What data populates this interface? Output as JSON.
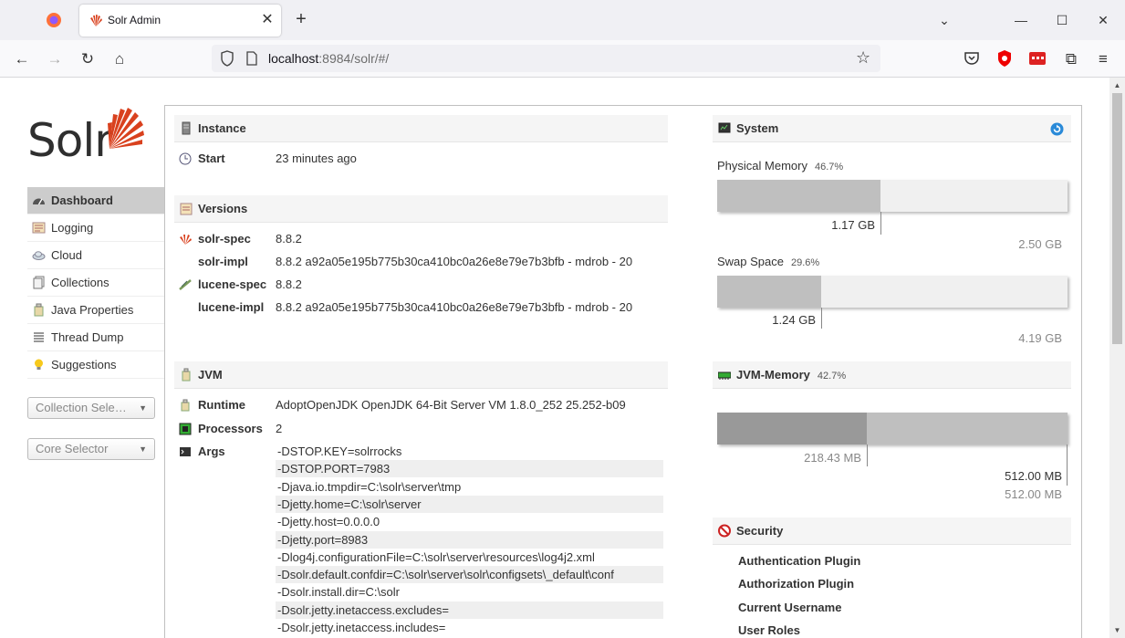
{
  "browser": {
    "tab_title": "Solr Admin",
    "url_host": "localhost",
    "url_rest": ":8984/solr/#/"
  },
  "logo_text": "Solr",
  "menu": {
    "items": [
      {
        "label": "Dashboard",
        "icon": "dashboard-icon"
      },
      {
        "label": "Logging",
        "icon": "logging-icon"
      },
      {
        "label": "Cloud",
        "icon": "cloud-icon"
      },
      {
        "label": "Collections",
        "icon": "collections-icon"
      },
      {
        "label": "Java Properties",
        "icon": "java-properties-icon"
      },
      {
        "label": "Thread Dump",
        "icon": "thread-dump-icon"
      },
      {
        "label": "Suggestions",
        "icon": "lightbulb-icon"
      }
    ],
    "collection_selector": "Collection Sele…",
    "core_selector": "Core Selector"
  },
  "instance": {
    "title": "Instance",
    "start_label": "Start",
    "start_value": "23 minutes ago"
  },
  "versions": {
    "title": "Versions",
    "rows": [
      {
        "key": "solr-spec",
        "value": "8.8.2"
      },
      {
        "key": "solr-impl",
        "value": "8.8.2 a92a05e195b775b30ca410bc0a26e8e79e7b3bfb - mdrob - 20"
      },
      {
        "key": "lucene-spec",
        "value": "8.8.2"
      },
      {
        "key": "lucene-impl",
        "value": "8.8.2 a92a05e195b775b30ca410bc0a26e8e79e7b3bfb - mdrob - 20"
      }
    ]
  },
  "jvm": {
    "title": "JVM",
    "runtime_label": "Runtime",
    "runtime_value": "AdoptOpenJDK OpenJDK 64-Bit Server VM 1.8.0_252 25.252-b09",
    "processors_label": "Processors",
    "processors_value": "2",
    "args_label": "Args",
    "args": [
      "-DSTOP.KEY=solrrocks",
      "-DSTOP.PORT=7983",
      "-Djava.io.tmpdir=C:\\solr\\server\\tmp",
      "-Djetty.home=C:\\solr\\server",
      "-Djetty.host=0.0.0.0",
      "-Djetty.port=8983",
      "-Dlog4j.configurationFile=C:\\solr\\server\\resources\\log4j2.xml",
      "-Dsolr.default.confdir=C:\\solr\\server\\solr\\configsets\\_default\\conf",
      "-Dsolr.install.dir=C:\\solr",
      "-Dsolr.jetty.inetaccess.excludes=",
      "-Dsolr.jetty.inetaccess.includes="
    ]
  },
  "system": {
    "title": "System",
    "physical": {
      "label": "Physical Memory",
      "pct": "46.7%",
      "fraction": 0.467,
      "used": "1.17 GB",
      "total": "2.50 GB"
    },
    "swap": {
      "label": "Swap Space",
      "pct": "29.6%",
      "fraction": 0.296,
      "used": "1.24 GB",
      "total": "4.19 GB"
    }
  },
  "jvm_memory": {
    "title": "JVM-Memory",
    "pct": "42.7%",
    "used_fraction": 0.427,
    "committed_fraction": 1.0,
    "used": "218.43 MB",
    "committed": "512.00 MB",
    "max": "512.00 MB"
  },
  "security": {
    "title": "Security",
    "items": [
      "Authentication Plugin",
      "Authorization Plugin",
      "Current Username",
      "User Roles"
    ]
  }
}
